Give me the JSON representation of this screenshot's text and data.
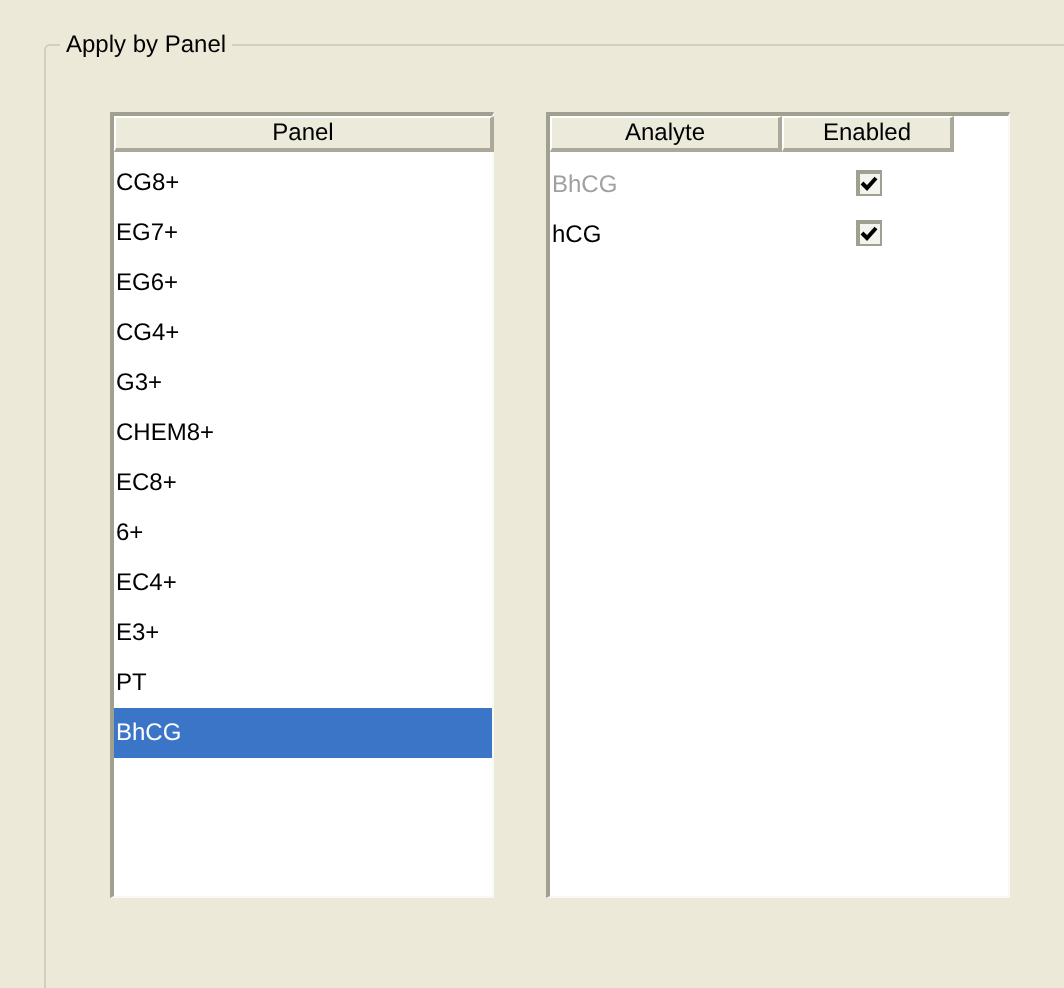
{
  "group": {
    "title": "Apply by Panel"
  },
  "panel_list": {
    "columns": [
      "Panel"
    ],
    "rows": [
      {
        "label": "CG8+",
        "selected": false
      },
      {
        "label": "EG7+",
        "selected": false
      },
      {
        "label": "EG6+",
        "selected": false
      },
      {
        "label": "CG4+",
        "selected": false
      },
      {
        "label": "G3+",
        "selected": false
      },
      {
        "label": "CHEM8+",
        "selected": false
      },
      {
        "label": "EC8+",
        "selected": false
      },
      {
        "label": "6+",
        "selected": false
      },
      {
        "label": "EC4+",
        "selected": false
      },
      {
        "label": "E3+",
        "selected": false
      },
      {
        "label": "PT",
        "selected": false
      },
      {
        "label": "BhCG",
        "selected": true
      }
    ]
  },
  "analyte_list": {
    "columns": [
      "Analyte",
      "Enabled"
    ],
    "rows": [
      {
        "analyte": "BhCG",
        "disabled": true,
        "enabled": true
      },
      {
        "analyte": "hCG",
        "disabled": false,
        "enabled": true
      }
    ]
  }
}
